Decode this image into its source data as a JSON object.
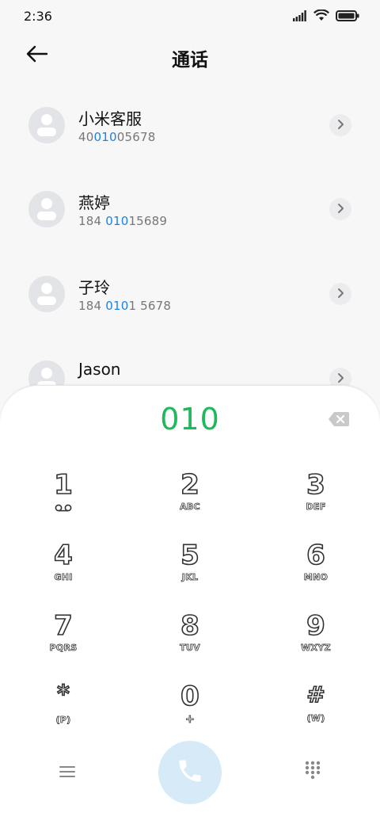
{
  "status_bar": {
    "time": "2:36",
    "icons": [
      "signal-icon",
      "wifi-icon",
      "battery-icon"
    ]
  },
  "header": {
    "title": "通话",
    "back_icon": "back-arrow-icon"
  },
  "contacts": [
    {
      "name": "小米客服",
      "number_parts": [
        "40",
        "010",
        "05678"
      ]
    },
    {
      "name": "燕婷",
      "number_parts": [
        "184 ",
        "010",
        "15689"
      ]
    },
    {
      "name": "子玲",
      "number_parts": [
        "184 ",
        "010",
        "1 5678"
      ]
    },
    {
      "name": "Jason",
      "number_parts": [
        "",
        "",
        ""
      ]
    }
  ],
  "dialpad": {
    "input_value": "010",
    "keys": [
      {
        "digit": "1",
        "sub": "OO"
      },
      {
        "digit": "2",
        "sub": "ABC"
      },
      {
        "digit": "3",
        "sub": "DEF"
      },
      {
        "digit": "4",
        "sub": "GHI"
      },
      {
        "digit": "5",
        "sub": "JKL"
      },
      {
        "digit": "6",
        "sub": "MNO"
      },
      {
        "digit": "7",
        "sub": "PQRS"
      },
      {
        "digit": "8",
        "sub": "TUV"
      },
      {
        "digit": "9",
        "sub": "WXYZ"
      },
      {
        "digit": "*",
        "sub": "(P)"
      },
      {
        "digit": "0",
        "sub": "+"
      },
      {
        "digit": "#",
        "sub": "(W)"
      }
    ]
  },
  "colors": {
    "accent_green": "#1fb85b",
    "highlight_blue": "#1a82e8",
    "call_button_bg": "#d6ebf7"
  }
}
